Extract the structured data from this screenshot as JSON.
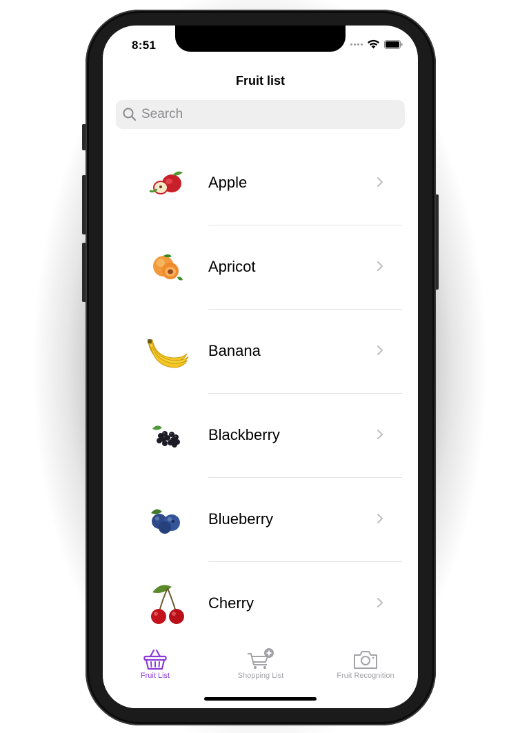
{
  "status": {
    "time": "8:51"
  },
  "nav": {
    "title": "Fruit list"
  },
  "search": {
    "placeholder": "Search",
    "value": ""
  },
  "fruits": [
    {
      "name": "Apple"
    },
    {
      "name": "Apricot"
    },
    {
      "name": "Banana"
    },
    {
      "name": "Blackberry"
    },
    {
      "name": "Blueberry"
    },
    {
      "name": "Cherry"
    }
  ],
  "tabs": [
    {
      "label": "Fruit List",
      "icon": "basket-icon",
      "selected": true
    },
    {
      "label": "Shopping List",
      "icon": "cart-plus-icon",
      "selected": false
    },
    {
      "label": "Fruit Recognition",
      "icon": "camera-icon",
      "selected": false
    }
  ],
  "colors": {
    "accent": "#8a3ad6",
    "inactive": "#a2a2a7",
    "search_bg": "#efeff0"
  }
}
